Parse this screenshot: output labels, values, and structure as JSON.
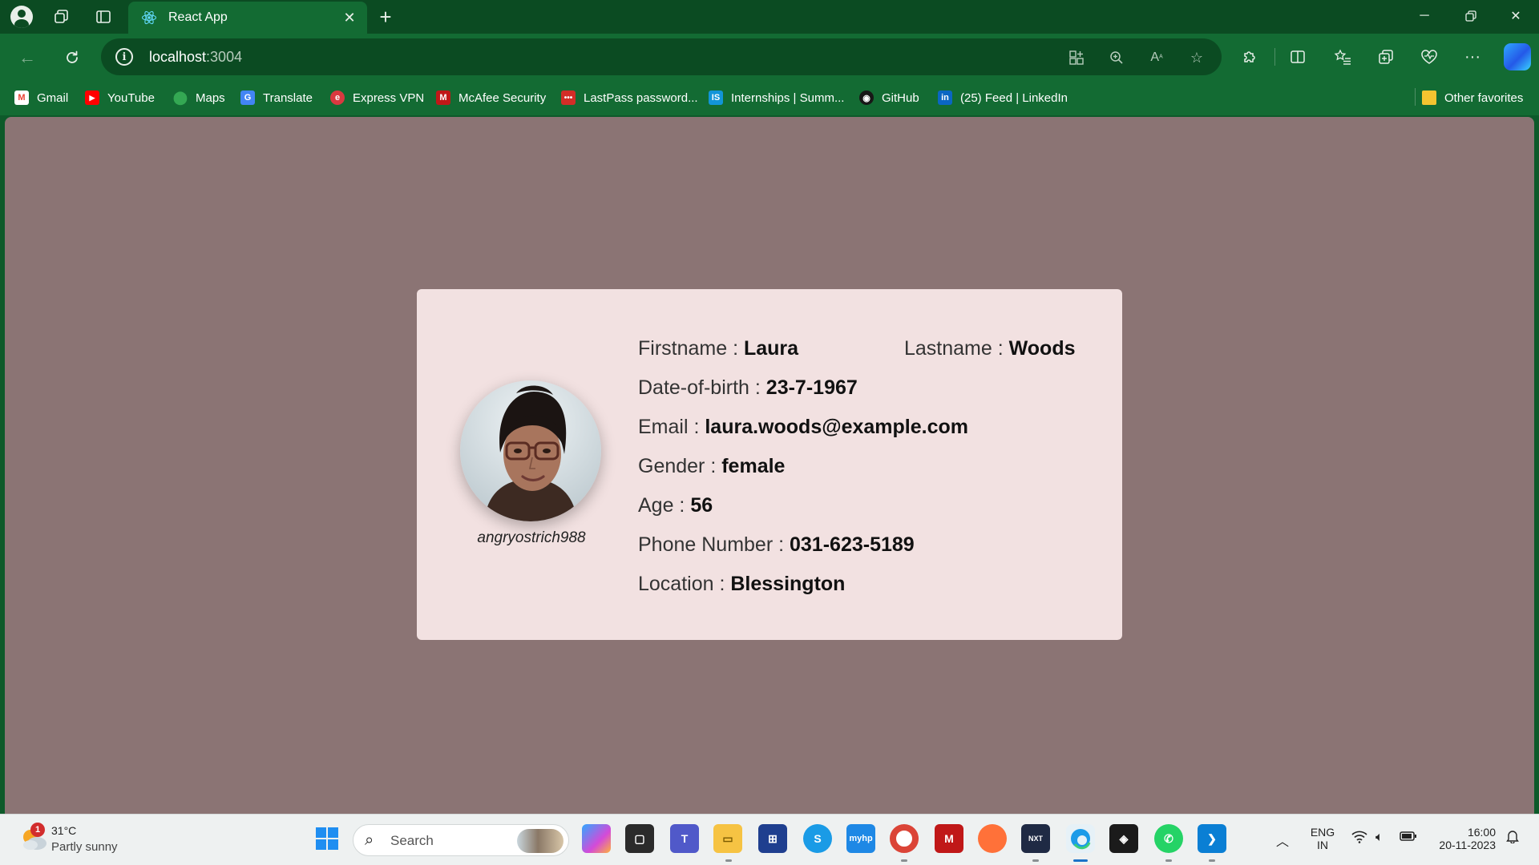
{
  "browser": {
    "tab_title": "React App",
    "url_host": "localhost",
    "url_port": ":3004",
    "favorites": [
      {
        "label": "Gmail",
        "icon": "gmail-icon",
        "color": "#ea4335"
      },
      {
        "label": "YouTube",
        "icon": "youtube-icon",
        "color": "#ff0000"
      },
      {
        "label": "Maps",
        "icon": "maps-icon",
        "color": "#34a853"
      },
      {
        "label": "Translate",
        "icon": "translate-icon",
        "color": "#4285f4"
      },
      {
        "label": "Express VPN",
        "icon": "expressvpn-icon",
        "color": "#da3940"
      },
      {
        "label": "McAfee Security",
        "icon": "mcafee-icon",
        "color": "#c01818"
      },
      {
        "label": "LastPass password...",
        "icon": "lastpass-icon",
        "color": "#d32d27"
      },
      {
        "label": "Internships | Summ...",
        "icon": "internshala-icon",
        "color": "#1295d8"
      },
      {
        "label": "GitHub",
        "icon": "github-icon",
        "color": "#181717"
      },
      {
        "label": "(25) Feed | LinkedIn",
        "icon": "linkedin-icon",
        "color": "#0a66c2"
      }
    ],
    "other_favorites": "Other favorites"
  },
  "profile": {
    "username": "angryostrich988",
    "firstname_label": "Firstname :",
    "firstname": "Laura",
    "lastname_label": "Lastname :",
    "lastname": "Woods",
    "dob_label": "Date-of-birth :",
    "dob": "23-7-1967",
    "email_label": "Email :",
    "email": "laura.woods@example.com",
    "gender_label": "Gender :",
    "gender": "female",
    "age_label": "Age :",
    "age": "56",
    "phone_label": "Phone Number :",
    "phone": "031-623-5189",
    "location_label": "Location :",
    "location": "Blessington"
  },
  "taskbar": {
    "weather_temp": "31°C",
    "weather_desc": "Partly sunny",
    "weather_badge": "1",
    "search_placeholder": "Search",
    "lang_top": "ENG",
    "lang_bottom": "IN",
    "time": "16:00",
    "date": "20-11-2023"
  },
  "colors": {
    "browser_frame": "#136b33",
    "page_background": "#8b7474",
    "card_background": "#f2e1e1"
  }
}
